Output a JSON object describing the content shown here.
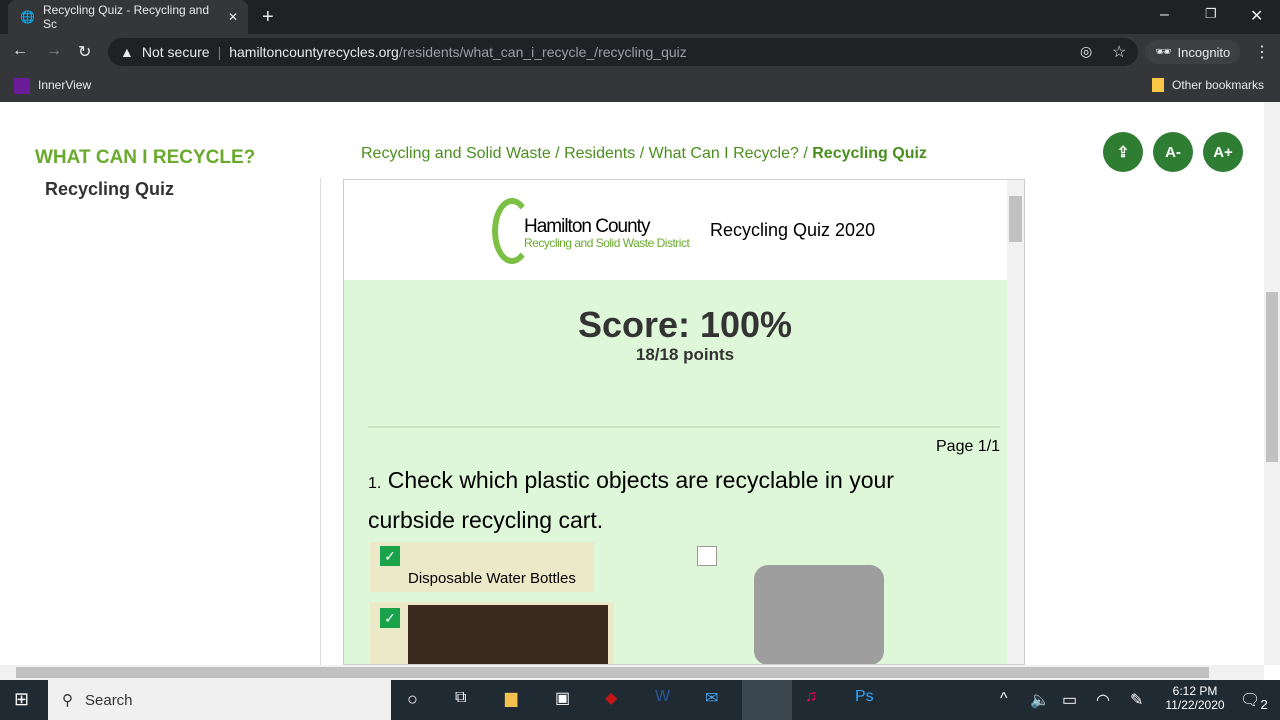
{
  "browser": {
    "tab_title": "Recycling Quiz - Recycling and Sc",
    "security": "Not secure",
    "url_domain": "hamiltoncountyrecycles.org",
    "url_path": "/residents/what_can_i_recycle_/recycling_quiz",
    "profile": "Incognito",
    "bookmark": "InnerView",
    "other_bookmarks": "Other bookmarks"
  },
  "sidebar": {
    "heading": "WHAT CAN I RECYCLE?",
    "item": "Recycling Quiz"
  },
  "breadcrumb": [
    "Recycling and Solid Waste",
    "Residents",
    "What Can I Recycle?",
    "Recycling Quiz"
  ],
  "breadcrumb_sep": "/",
  "tools": {
    "font_down": "A-",
    "font_up": "A+"
  },
  "quiz": {
    "logo_line1": "Hamilton County",
    "logo_line2": "Recycling and Solid Waste District",
    "title": "Recycling Quiz 2020",
    "score": "Score: 100%",
    "points": "18/18 points",
    "page": "Page 1/1",
    "q_num": "1.",
    "question": "Check which plastic objects are recyclable in your curbside recycling cart.",
    "option1": "Disposable Water Bottles"
  },
  "taskbar": {
    "search": "Search",
    "time": "6:12 PM",
    "date": "11/22/2020",
    "notifications": "2"
  },
  "colors": {
    "accent": "#6aaa2e",
    "button": "#2e7d32",
    "quiz_bg": "#dff7d9",
    "check": "#1aa34a"
  }
}
